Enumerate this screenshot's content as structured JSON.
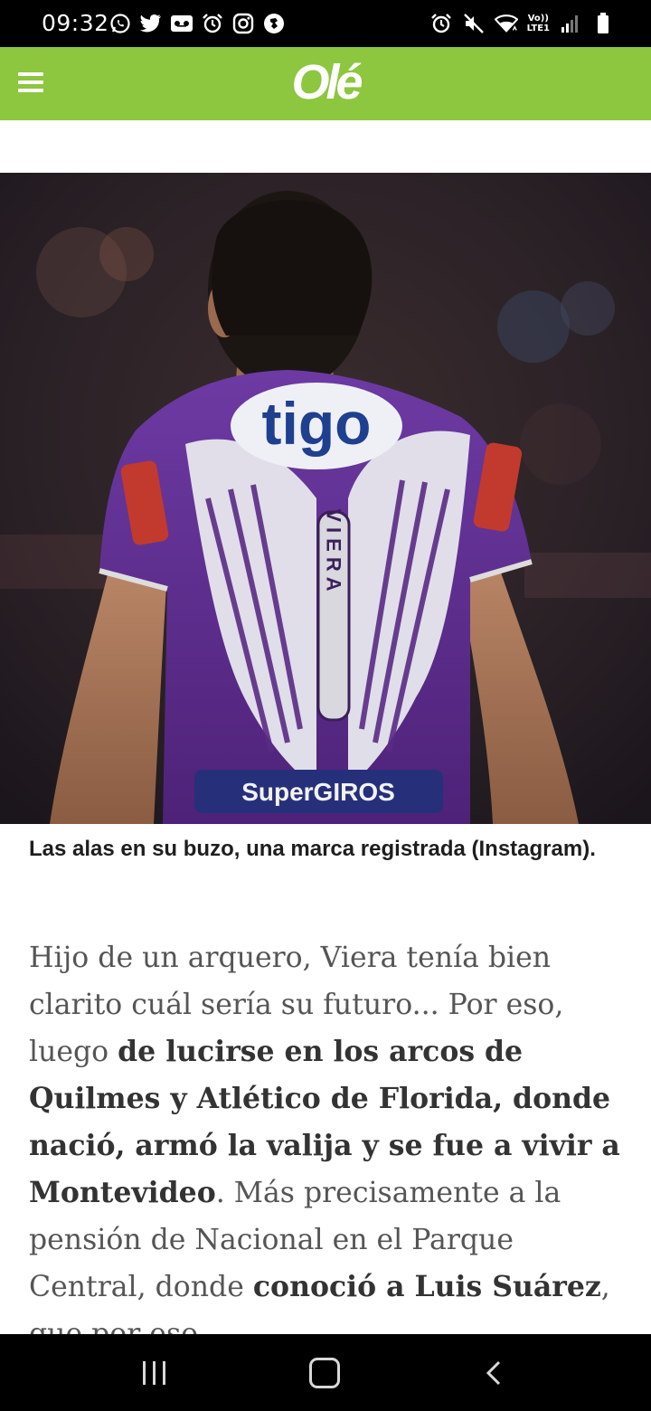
{
  "status_bar": {
    "time": "09:32",
    "left_icons": [
      "whatsapp-icon",
      "twitter-icon",
      "voicemail-icon",
      "alarm-icon",
      "instagram-icon",
      "chelsea-icon"
    ],
    "volte_top": "Vo))",
    "volte_bottom": "LTE1"
  },
  "header": {
    "logo": "Olé",
    "background": "#8dc63f"
  },
  "article": {
    "image_alt": "Jugador con camiseta violeta con alas y el nombre VIERA",
    "jersey": {
      "sponsor": "tigo",
      "name": "VIERA",
      "lower_sponsor": "SuperGIROS"
    },
    "caption": "Las alas en su buzo, una marca registrada (Instagram).",
    "body": {
      "p1": "Hijo de un arquero, Viera tenía bien clarito cuál sería su futuro... Por eso, luego ",
      "b1": "de lucirse en los arcos de Quilmes y Atlético de Florida, donde nació, armó la valija y se fue a vivir a Montevideo",
      "p2": ". Más precisamente a la pensión de Nacional en el Parque Central, donde ",
      "b2": "conoció a Luis Suárez",
      "p3": ", que por eso"
    }
  },
  "nav": {
    "recent": "recent-apps",
    "home": "home",
    "back": "back"
  }
}
